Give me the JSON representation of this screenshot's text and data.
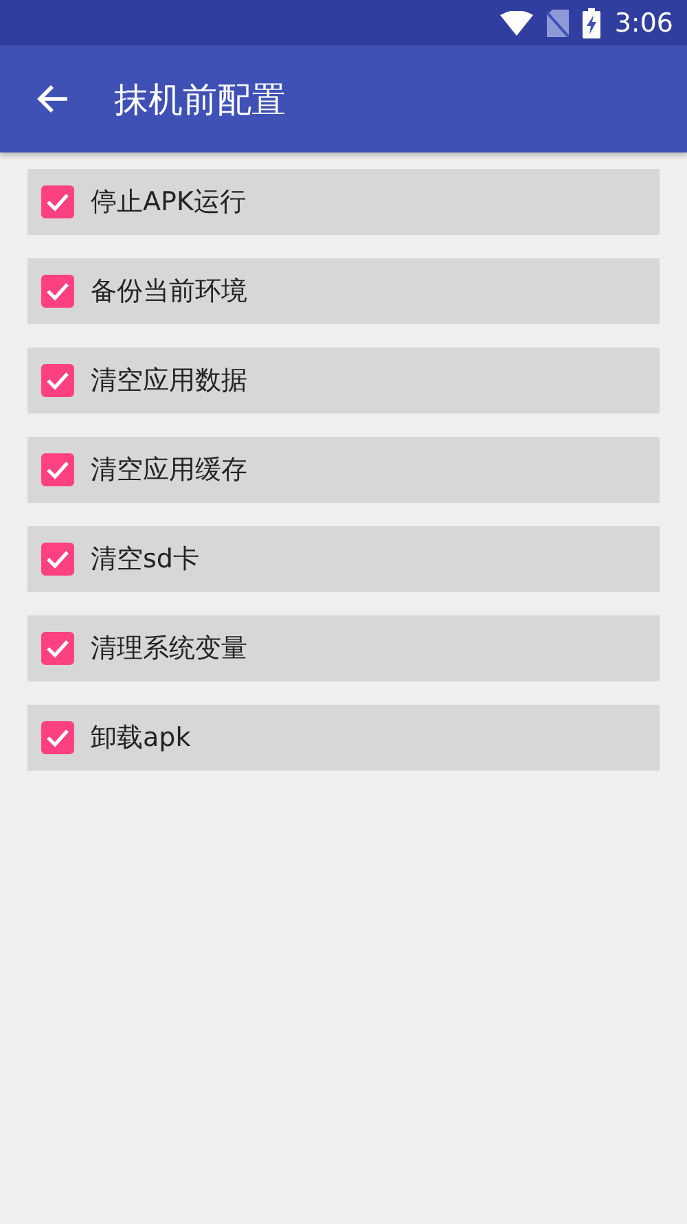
{
  "status_bar": {
    "time": "3:06"
  },
  "app_bar": {
    "title": "抹机前配置"
  },
  "options": [
    {
      "label": "停止APK运行",
      "checked": true
    },
    {
      "label": "备份当前环境",
      "checked": true
    },
    {
      "label": "清空应用数据",
      "checked": true
    },
    {
      "label": "清空应用缓存",
      "checked": true
    },
    {
      "label": "清空sd卡",
      "checked": true
    },
    {
      "label": "清理系统变量",
      "checked": true
    },
    {
      "label": "卸载apk",
      "checked": true
    }
  ]
}
